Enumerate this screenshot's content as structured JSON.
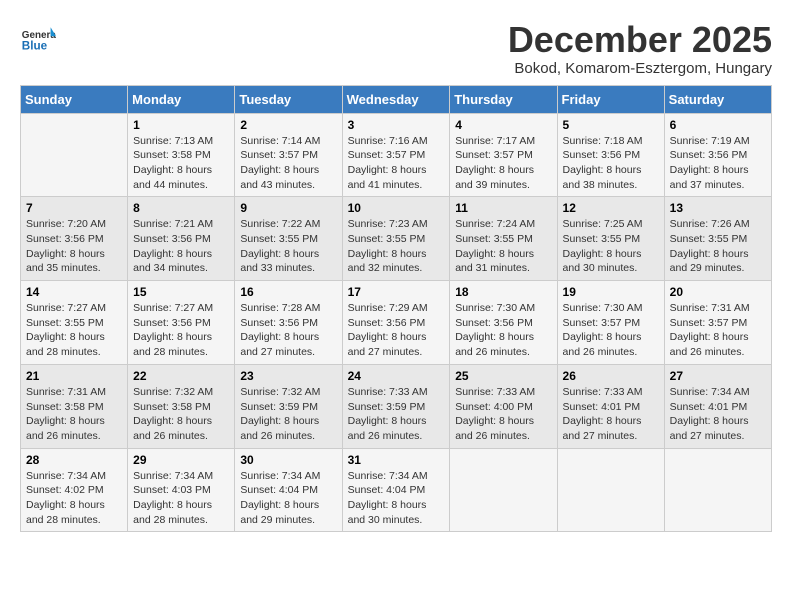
{
  "logo": {
    "general": "General",
    "blue": "Blue"
  },
  "title": "December 2025",
  "location": "Bokod, Komarom-Esztergom, Hungary",
  "weekdays": [
    "Sunday",
    "Monday",
    "Tuesday",
    "Wednesday",
    "Thursday",
    "Friday",
    "Saturday"
  ],
  "weeks": [
    [
      {
        "day": "",
        "info": ""
      },
      {
        "day": "1",
        "info": "Sunrise: 7:13 AM\nSunset: 3:58 PM\nDaylight: 8 hours\nand 44 minutes."
      },
      {
        "day": "2",
        "info": "Sunrise: 7:14 AM\nSunset: 3:57 PM\nDaylight: 8 hours\nand 43 minutes."
      },
      {
        "day": "3",
        "info": "Sunrise: 7:16 AM\nSunset: 3:57 PM\nDaylight: 8 hours\nand 41 minutes."
      },
      {
        "day": "4",
        "info": "Sunrise: 7:17 AM\nSunset: 3:57 PM\nDaylight: 8 hours\nand 39 minutes."
      },
      {
        "day": "5",
        "info": "Sunrise: 7:18 AM\nSunset: 3:56 PM\nDaylight: 8 hours\nand 38 minutes."
      },
      {
        "day": "6",
        "info": "Sunrise: 7:19 AM\nSunset: 3:56 PM\nDaylight: 8 hours\nand 37 minutes."
      }
    ],
    [
      {
        "day": "7",
        "info": "Sunrise: 7:20 AM\nSunset: 3:56 PM\nDaylight: 8 hours\nand 35 minutes."
      },
      {
        "day": "8",
        "info": "Sunrise: 7:21 AM\nSunset: 3:56 PM\nDaylight: 8 hours\nand 34 minutes."
      },
      {
        "day": "9",
        "info": "Sunrise: 7:22 AM\nSunset: 3:55 PM\nDaylight: 8 hours\nand 33 minutes."
      },
      {
        "day": "10",
        "info": "Sunrise: 7:23 AM\nSunset: 3:55 PM\nDaylight: 8 hours\nand 32 minutes."
      },
      {
        "day": "11",
        "info": "Sunrise: 7:24 AM\nSunset: 3:55 PM\nDaylight: 8 hours\nand 31 minutes."
      },
      {
        "day": "12",
        "info": "Sunrise: 7:25 AM\nSunset: 3:55 PM\nDaylight: 8 hours\nand 30 minutes."
      },
      {
        "day": "13",
        "info": "Sunrise: 7:26 AM\nSunset: 3:55 PM\nDaylight: 8 hours\nand 29 minutes."
      }
    ],
    [
      {
        "day": "14",
        "info": "Sunrise: 7:27 AM\nSunset: 3:55 PM\nDaylight: 8 hours\nand 28 minutes."
      },
      {
        "day": "15",
        "info": "Sunrise: 7:27 AM\nSunset: 3:56 PM\nDaylight: 8 hours\nand 28 minutes."
      },
      {
        "day": "16",
        "info": "Sunrise: 7:28 AM\nSunset: 3:56 PM\nDaylight: 8 hours\nand 27 minutes."
      },
      {
        "day": "17",
        "info": "Sunrise: 7:29 AM\nSunset: 3:56 PM\nDaylight: 8 hours\nand 27 minutes."
      },
      {
        "day": "18",
        "info": "Sunrise: 7:30 AM\nSunset: 3:56 PM\nDaylight: 8 hours\nand 26 minutes."
      },
      {
        "day": "19",
        "info": "Sunrise: 7:30 AM\nSunset: 3:57 PM\nDaylight: 8 hours\nand 26 minutes."
      },
      {
        "day": "20",
        "info": "Sunrise: 7:31 AM\nSunset: 3:57 PM\nDaylight: 8 hours\nand 26 minutes."
      }
    ],
    [
      {
        "day": "21",
        "info": "Sunrise: 7:31 AM\nSunset: 3:58 PM\nDaylight: 8 hours\nand 26 minutes."
      },
      {
        "day": "22",
        "info": "Sunrise: 7:32 AM\nSunset: 3:58 PM\nDaylight: 8 hours\nand 26 minutes."
      },
      {
        "day": "23",
        "info": "Sunrise: 7:32 AM\nSunset: 3:59 PM\nDaylight: 8 hours\nand 26 minutes."
      },
      {
        "day": "24",
        "info": "Sunrise: 7:33 AM\nSunset: 3:59 PM\nDaylight: 8 hours\nand 26 minutes."
      },
      {
        "day": "25",
        "info": "Sunrise: 7:33 AM\nSunset: 4:00 PM\nDaylight: 8 hours\nand 26 minutes."
      },
      {
        "day": "26",
        "info": "Sunrise: 7:33 AM\nSunset: 4:01 PM\nDaylight: 8 hours\nand 27 minutes."
      },
      {
        "day": "27",
        "info": "Sunrise: 7:34 AM\nSunset: 4:01 PM\nDaylight: 8 hours\nand 27 minutes."
      }
    ],
    [
      {
        "day": "28",
        "info": "Sunrise: 7:34 AM\nSunset: 4:02 PM\nDaylight: 8 hours\nand 28 minutes."
      },
      {
        "day": "29",
        "info": "Sunrise: 7:34 AM\nSunset: 4:03 PM\nDaylight: 8 hours\nand 28 minutes."
      },
      {
        "day": "30",
        "info": "Sunrise: 7:34 AM\nSunset: 4:04 PM\nDaylight: 8 hours\nand 29 minutes."
      },
      {
        "day": "31",
        "info": "Sunrise: 7:34 AM\nSunset: 4:04 PM\nDaylight: 8 hours\nand 30 minutes."
      },
      {
        "day": "",
        "info": ""
      },
      {
        "day": "",
        "info": ""
      },
      {
        "day": "",
        "info": ""
      }
    ]
  ]
}
